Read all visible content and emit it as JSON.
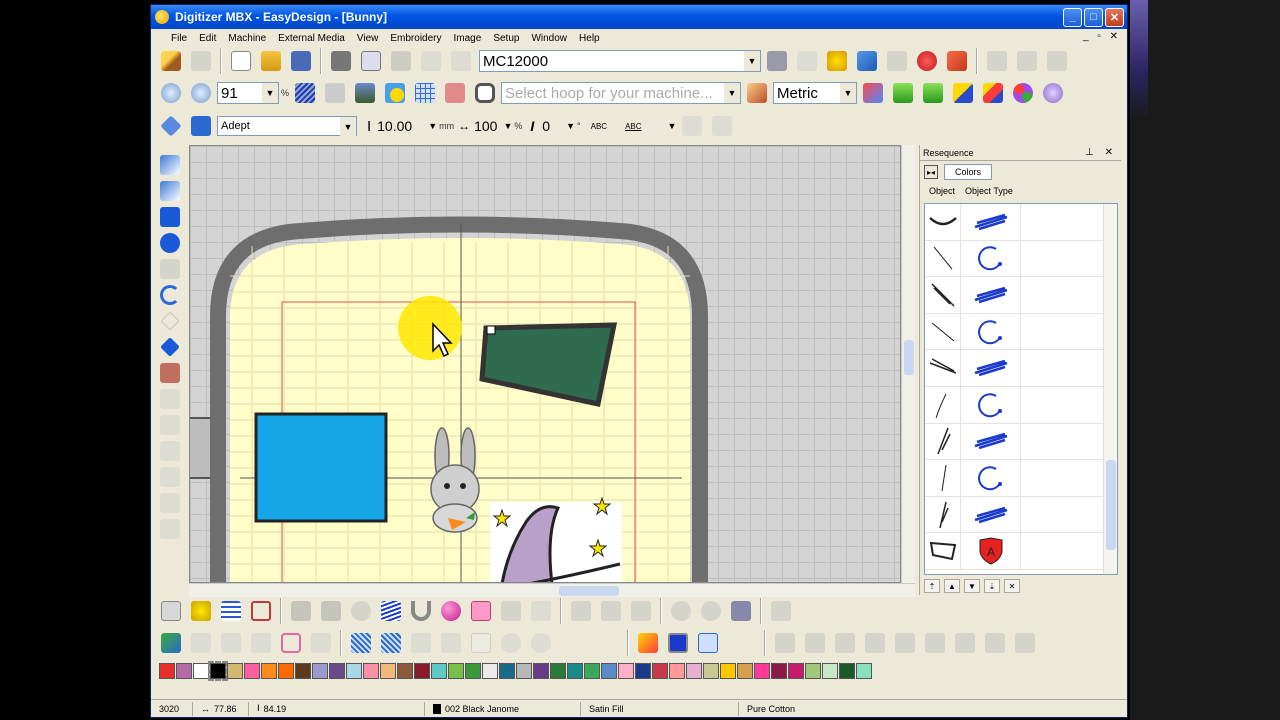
{
  "window": {
    "title": "Digitizer MBX - EasyDesign - [Bunny]"
  },
  "menu": [
    "File",
    "Edit",
    "Machine",
    "External Media",
    "View",
    "Embroidery",
    "Image",
    "Setup",
    "Window",
    "Help"
  ],
  "toolbar1": {
    "machine": "MC12000"
  },
  "toolbar2": {
    "zoom": "91",
    "zoom_unit": "%",
    "hoop_placeholder": "Select hoop for your machine...",
    "units": "Metric"
  },
  "toolbar3": {
    "font": "Adept",
    "height": "10.00",
    "height_unit": "mm",
    "width": "100",
    "width_unit": "%",
    "italic_label": "I",
    "slant": "0",
    "slant_unit": "°",
    "abc1": "ABC",
    "abc2": "ABC"
  },
  "resequence": {
    "title": "Resequence",
    "tab_colors": "Colors",
    "col_object": "Object",
    "col_type": "Object Type",
    "rows": [
      {
        "object": "curve",
        "type": "fill-stroke"
      },
      {
        "object": "line",
        "type": "circle-arrow"
      },
      {
        "object": "curve2",
        "type": "fill-stroke"
      },
      {
        "object": "line",
        "type": "circle-arrow"
      },
      {
        "object": "curve3",
        "type": "fill-stroke"
      },
      {
        "object": "line2",
        "type": "circle-arrow"
      },
      {
        "object": "curve4",
        "type": "fill-stroke"
      },
      {
        "object": "line3",
        "type": "circle-arrow"
      },
      {
        "object": "curve5",
        "type": "fill-stroke"
      },
      {
        "object": "shape",
        "type": "shield-a"
      }
    ],
    "shield_letter": "A"
  },
  "palette": [
    "#e8302a",
    "#b56aa8",
    "#ffffff",
    "#000000",
    "#d4b870",
    "#ff5fa0",
    "#ff8c1a",
    "#ff6a00",
    "#5a3b1a",
    "#9b9bd0",
    "#6a4a8a",
    "#a8d8e8",
    "#ff8fa8",
    "#f2b87a",
    "#8a5a3a",
    "#8a1a2a",
    "#5fc8c8",
    "#7abf4a",
    "#3a9a3a",
    "#eaeaea",
    "#1a6a8a",
    "#b8b8b8",
    "#6a3a8a",
    "#2a7a3a",
    "#1a8a8a",
    "#3aaa5a",
    "#5a8ac8",
    "#ffb0c8",
    "#1a3a8a",
    "#c83a4a",
    "#ff9a9a",
    "#e8b0d0",
    "#c8c890",
    "#ffc800",
    "#d4a050",
    "#ff3a9a",
    "#8a1a4a",
    "#c81a6a",
    "#a0c878",
    "#c8e8c8",
    "#1a5a2a",
    "#88e0c0"
  ],
  "status": {
    "stitches": "3020",
    "width": "77.86",
    "height": "84.19",
    "thread": "002 Black Janome",
    "fill": "Satin Fill",
    "fabric": "Pure Cotton"
  },
  "colors": {
    "titlebar": "#0054e3",
    "hoop_fill": "#fffdc8",
    "panel_green": "#2f6b4e",
    "rect_blue": "#16a5e6",
    "highlight": "#ffe800"
  }
}
